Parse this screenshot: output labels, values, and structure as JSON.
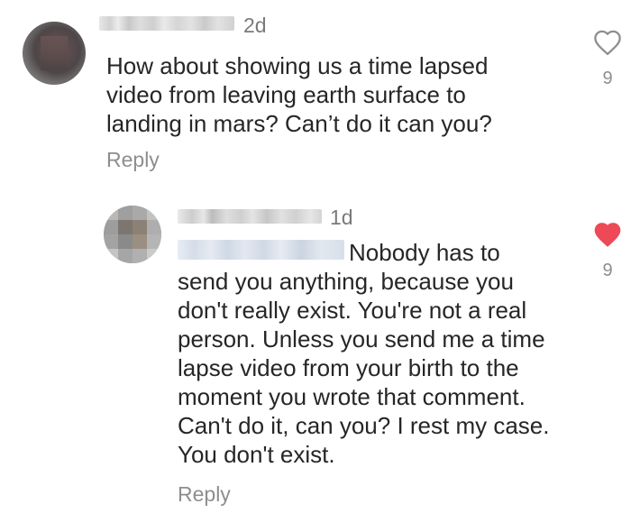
{
  "comments": [
    {
      "time": "2d",
      "text": "How about showing us a time lapsed\nvideo from leaving earth surface to\nlanding in mars? Can’t do it can you?",
      "reply_label": "Reply",
      "likes": "9",
      "liked": false
    },
    {
      "time": "1d",
      "text": "Nobody has to\nsend you anything, because you\ndon't really exist. You're not a real\nperson. Unless you send me a time\nlapse video from your birth to the\nmoment you wrote that comment.\nCan't do it, can you? I rest my case.\nYou don't exist.",
      "reply_label": "Reply",
      "likes": "9",
      "liked": true
    }
  ],
  "colors": {
    "heart_liked": "#ed4956",
    "heart_outline": "#8e8e8e",
    "meta_text": "#8e8e8e",
    "body_text": "#262626"
  },
  "icons": {
    "like_outline": "heart-outline-icon",
    "like_filled": "heart-filled-icon"
  }
}
